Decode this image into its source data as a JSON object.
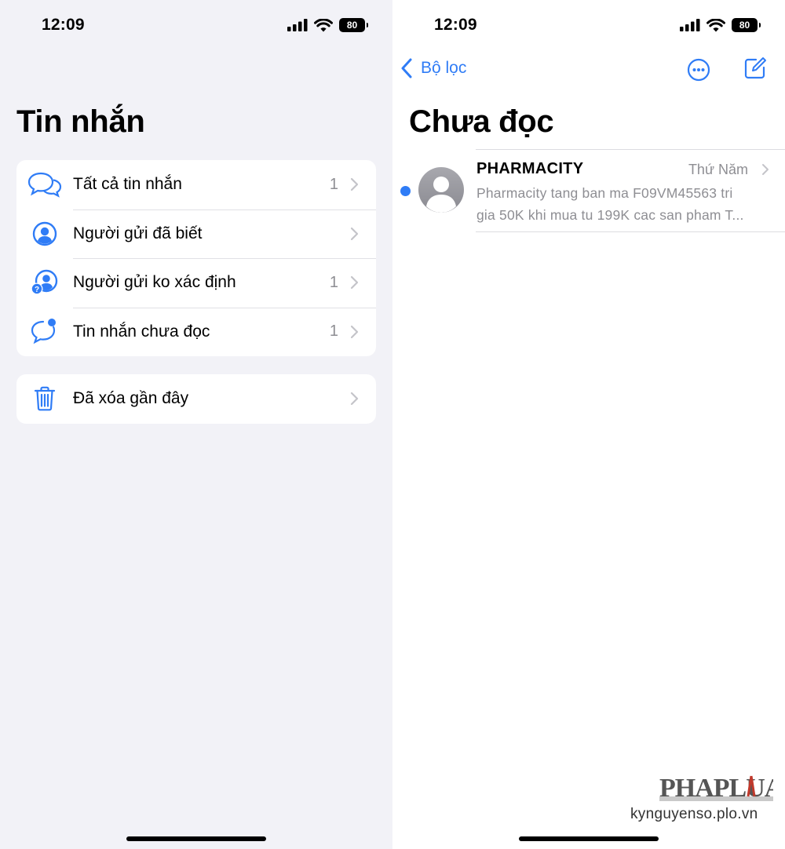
{
  "left": {
    "status": {
      "time": "12:09",
      "battery": "80"
    },
    "title": "Tin nhắn",
    "filters": [
      {
        "label": "Tất cả tin nhắn",
        "count": "1",
        "icon": "two-chat-bubbles-icon"
      },
      {
        "label": "Người gửi đã biết",
        "count": "",
        "icon": "person-circle-icon"
      },
      {
        "label": "Người gửi ko xác định",
        "count": "1",
        "icon": "person-question-icon"
      },
      {
        "label": "Tin nhắn chưa đọc",
        "count": "1",
        "icon": "chat-bubble-badge-icon"
      }
    ],
    "deleted": {
      "label": "Đã xóa gần đây",
      "icon": "trash-icon"
    }
  },
  "right": {
    "status": {
      "time": "12:09",
      "battery": "80"
    },
    "nav": {
      "back_label": "Bộ lọc"
    },
    "title": "Chưa đọc",
    "messages": [
      {
        "sender": "PHARMACITY",
        "date": "Thứ Năm",
        "preview_line1": "Pharmacity tang ban ma F09VM45563 tri",
        "preview_line2": "gia 50K khi mua tu 199K cac san pham T...",
        "unread": true
      }
    ]
  },
  "watermark": {
    "logo": "PHAPLUAT",
    "site": "kynguyenso.plo.vn"
  },
  "colors": {
    "accent": "#2f7cf6",
    "background_grouped": "#f2f2f7",
    "secondary_text": "#8e8e93"
  }
}
